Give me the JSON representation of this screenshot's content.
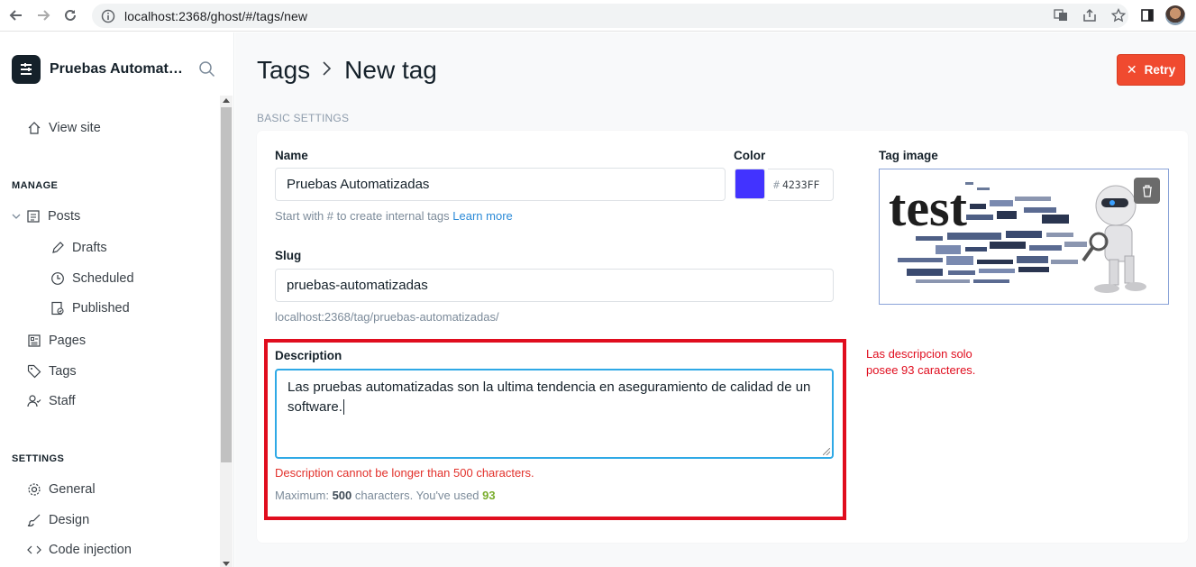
{
  "browser": {
    "url": "localhost:2368/ghost/#/tags/new"
  },
  "sidebar": {
    "site_name": "Pruebas Automatizadas",
    "view_site": "View site",
    "manage_title": "MANAGE",
    "settings_title": "SETTINGS",
    "items": {
      "posts": "Posts",
      "drafts": "Drafts",
      "scheduled": "Scheduled",
      "published": "Published",
      "pages": "Pages",
      "tags": "Tags",
      "staff": "Staff",
      "general": "General",
      "design": "Design",
      "code_injection": "Code injection"
    }
  },
  "header": {
    "breadcrumb_parent": "Tags",
    "breadcrumb_current": "New tag",
    "retry_label": "Retry"
  },
  "form": {
    "section_label": "BASIC SETTINGS",
    "name_label": "Name",
    "name_value": "Pruebas Automatizadas",
    "name_hint": "Start with # to create internal tags",
    "learn_more": "Learn more",
    "color_label": "Color",
    "color_hash": "#",
    "color_value": "4233FF",
    "color_hex": "#4233FF",
    "slug_label": "Slug",
    "slug_value": "pruebas-automatizadas",
    "slug_url": "localhost:2368/tag/pruebas-automatizadas/",
    "description_label": "Description",
    "description_value": "Las pruebas automatizadas son la ultima tendencia en aseguramiento de calidad de un software.",
    "description_error": "Description cannot be longer than 500 characters.",
    "maximum_prefix": "Maximum:",
    "maximum_value": "500",
    "maximum_suffix": "characters. You've used",
    "used_value": "93",
    "tag_image_label": "Tag image",
    "tag_image_word": "test"
  },
  "annotation": {
    "text": "Las descripcion solo posee 93 caracteres."
  }
}
